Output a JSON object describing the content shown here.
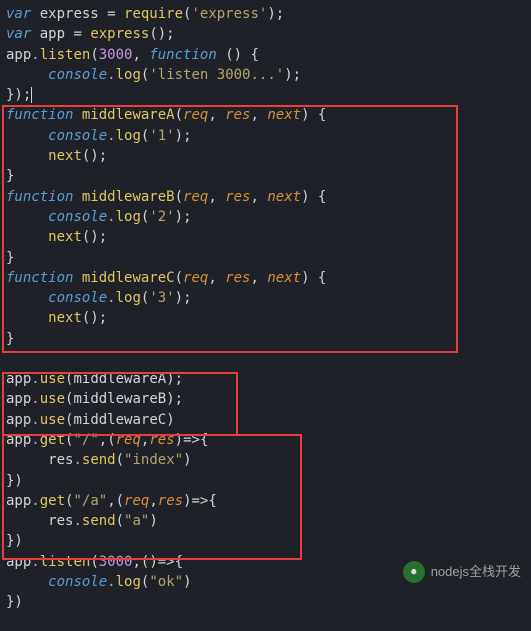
{
  "code": {
    "l1_var1": "var",
    "l1_ident": " express ",
    "l1_eq": "= ",
    "l1_req": "require",
    "l1_p1": "(",
    "l1_str": "'express'",
    "l1_p2": ");",
    "l2_var": "var",
    "l2_rest": " app = ",
    "l2_fn": "express",
    "l2_p": "();",
    "l3_app": "app",
    "l3_dot": ".",
    "l3_fn": "listen",
    "l3_p1": "(",
    "l3_num": "3000",
    "l3_c": ", ",
    "l3_fun": "function",
    "l3_p2": " () {",
    "l4_pad": "     ",
    "l4_cons": "console",
    "l4_dot": ".",
    "l4_fn": "log",
    "l4_p1": "(",
    "l4_str": "'listen 3000...'",
    "l4_p2": ");",
    "l5": "});",
    "fa_fun": "function",
    "fa_name": " middlewareA",
    "fa_p1": "(",
    "fa_req": "req",
    "fa_c1": ", ",
    "fa_res": "res",
    "fa_c2": ", ",
    "fa_next": "next",
    "fa_p2": ") {",
    "fa_b1_pad": "     ",
    "fa_b1_cons": "console",
    "fa_b1_dot": ".",
    "fa_b1_fn": "log",
    "fa_b1_p1": "(",
    "fa_b1_str": "'1'",
    "fa_b1_p2": ");",
    "fa_b2_pad": "     ",
    "fa_b2_fn": "next",
    "fa_b2_p": "();",
    "fa_close": "}",
    "fb_fun": "function",
    "fb_name": " middlewareB",
    "fb_p1": "(",
    "fb_req": "req",
    "fb_c1": ", ",
    "fb_res": "res",
    "fb_c2": ", ",
    "fb_next": "next",
    "fb_p2": ") {",
    "fb_b1_pad": "     ",
    "fb_b1_cons": "console",
    "fb_b1_dot": ".",
    "fb_b1_fn": "log",
    "fb_b1_p1": "(",
    "fb_b1_str": "'2'",
    "fb_b1_p2": ");",
    "fb_b2_pad": "     ",
    "fb_b2_fn": "next",
    "fb_b2_p": "();",
    "fb_close": "}",
    "fc_fun": "function",
    "fc_name": " middlewareC",
    "fc_p1": "(",
    "fc_req": "req",
    "fc_c1": ", ",
    "fc_res": "res",
    "fc_c2": ", ",
    "fc_next": "next",
    "fc_p2": ") {",
    "fc_b1_pad": "     ",
    "fc_b1_cons": "console",
    "fc_b1_dot": ".",
    "fc_b1_fn": "log",
    "fc_b1_p1": "(",
    "fc_b1_str": "'3'",
    "fc_b1_p2": ");",
    "fc_b2_pad": "     ",
    "fc_b2_fn": "next",
    "fc_b2_p": "();",
    "fc_close": "}",
    "blank": "",
    "u1_app": "app",
    "u1_dot": ".",
    "u1_fn": "use",
    "u1_p1": "(",
    "u1_arg": "middlewareA",
    "u1_p2": ");",
    "u2_app": "app",
    "u2_dot": ".",
    "u2_fn": "use",
    "u2_p1": "(",
    "u2_arg": "middlewareB",
    "u2_p2": ");",
    "u3_app": "app",
    "u3_dot": ".",
    "u3_fn": "use",
    "u3_p1": "(",
    "u3_arg": "middlewareC",
    "u3_p2": ")",
    "g1_app": "app",
    "g1_dot": ".",
    "g1_fn": "get",
    "g1_p1": "(",
    "g1_str": "\"/\"",
    "g1_c": ",(",
    "g1_req": "req",
    "g1_cm": ",",
    "g1_res": "res",
    "g1_ar": ")=>{",
    "g1_b_pad": "     ",
    "g1_b_res": "res",
    "g1_b_dot": ".",
    "g1_b_fn": "send",
    "g1_b_p1": "(",
    "g1_b_str": "\"index\"",
    "g1_b_p2": ")",
    "g1_close": "})",
    "g2_app": "app",
    "g2_dot": ".",
    "g2_fn": "get",
    "g2_p1": "(",
    "g2_str": "\"/a\"",
    "g2_c": ",(",
    "g2_req": "req",
    "g2_cm": ",",
    "g2_res": "res",
    "g2_ar": ")=>{",
    "g2_b_pad": "     ",
    "g2_b_res": "res",
    "g2_b_dot": ".",
    "g2_b_fn": "send",
    "g2_b_p1": "(",
    "g2_b_str": "\"a\"",
    "g2_b_p2": ")",
    "g2_close": "})",
    "li_app": "app",
    "li_dot": ".",
    "li_fn": "listen",
    "li_p1": "(",
    "li_num": "3000",
    "li_c": ",()=>{",
    "li_b_pad": "     ",
    "li_b_cons": "console",
    "li_b_dot": ".",
    "li_b_fn": "log",
    "li_b_p1": "(",
    "li_b_str": "\"ok\"",
    "li_b_p2": ")",
    "li_close": "})"
  },
  "watermark": {
    "icon_text": "●",
    "text": "nodejs全栈开发"
  }
}
